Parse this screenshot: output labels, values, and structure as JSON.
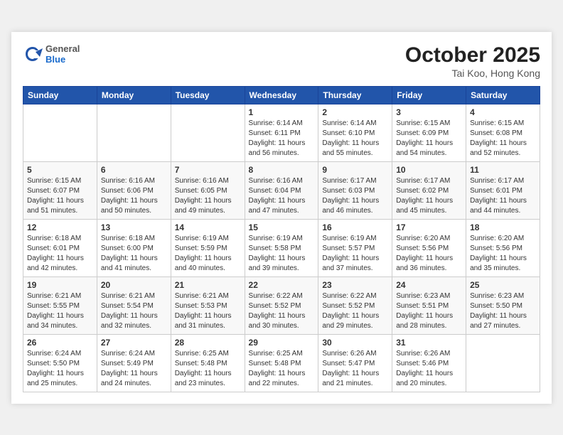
{
  "header": {
    "logo": {
      "general": "General",
      "blue": "Blue"
    },
    "title": "October 2025",
    "location": "Tai Koo, Hong Kong"
  },
  "weekdays": [
    "Sunday",
    "Monday",
    "Tuesday",
    "Wednesday",
    "Thursday",
    "Friday",
    "Saturday"
  ],
  "weeks": [
    [
      {
        "day": "",
        "info": ""
      },
      {
        "day": "",
        "info": ""
      },
      {
        "day": "",
        "info": ""
      },
      {
        "day": "1",
        "info": "Sunrise: 6:14 AM\nSunset: 6:11 PM\nDaylight: 11 hours\nand 56 minutes."
      },
      {
        "day": "2",
        "info": "Sunrise: 6:14 AM\nSunset: 6:10 PM\nDaylight: 11 hours\nand 55 minutes."
      },
      {
        "day": "3",
        "info": "Sunrise: 6:15 AM\nSunset: 6:09 PM\nDaylight: 11 hours\nand 54 minutes."
      },
      {
        "day": "4",
        "info": "Sunrise: 6:15 AM\nSunset: 6:08 PM\nDaylight: 11 hours\nand 52 minutes."
      }
    ],
    [
      {
        "day": "5",
        "info": "Sunrise: 6:15 AM\nSunset: 6:07 PM\nDaylight: 11 hours\nand 51 minutes."
      },
      {
        "day": "6",
        "info": "Sunrise: 6:16 AM\nSunset: 6:06 PM\nDaylight: 11 hours\nand 50 minutes."
      },
      {
        "day": "7",
        "info": "Sunrise: 6:16 AM\nSunset: 6:05 PM\nDaylight: 11 hours\nand 49 minutes."
      },
      {
        "day": "8",
        "info": "Sunrise: 6:16 AM\nSunset: 6:04 PM\nDaylight: 11 hours\nand 47 minutes."
      },
      {
        "day": "9",
        "info": "Sunrise: 6:17 AM\nSunset: 6:03 PM\nDaylight: 11 hours\nand 46 minutes."
      },
      {
        "day": "10",
        "info": "Sunrise: 6:17 AM\nSunset: 6:02 PM\nDaylight: 11 hours\nand 45 minutes."
      },
      {
        "day": "11",
        "info": "Sunrise: 6:17 AM\nSunset: 6:01 PM\nDaylight: 11 hours\nand 44 minutes."
      }
    ],
    [
      {
        "day": "12",
        "info": "Sunrise: 6:18 AM\nSunset: 6:01 PM\nDaylight: 11 hours\nand 42 minutes."
      },
      {
        "day": "13",
        "info": "Sunrise: 6:18 AM\nSunset: 6:00 PM\nDaylight: 11 hours\nand 41 minutes."
      },
      {
        "day": "14",
        "info": "Sunrise: 6:19 AM\nSunset: 5:59 PM\nDaylight: 11 hours\nand 40 minutes."
      },
      {
        "day": "15",
        "info": "Sunrise: 6:19 AM\nSunset: 5:58 PM\nDaylight: 11 hours\nand 39 minutes."
      },
      {
        "day": "16",
        "info": "Sunrise: 6:19 AM\nSunset: 5:57 PM\nDaylight: 11 hours\nand 37 minutes."
      },
      {
        "day": "17",
        "info": "Sunrise: 6:20 AM\nSunset: 5:56 PM\nDaylight: 11 hours\nand 36 minutes."
      },
      {
        "day": "18",
        "info": "Sunrise: 6:20 AM\nSunset: 5:56 PM\nDaylight: 11 hours\nand 35 minutes."
      }
    ],
    [
      {
        "day": "19",
        "info": "Sunrise: 6:21 AM\nSunset: 5:55 PM\nDaylight: 11 hours\nand 34 minutes."
      },
      {
        "day": "20",
        "info": "Sunrise: 6:21 AM\nSunset: 5:54 PM\nDaylight: 11 hours\nand 32 minutes."
      },
      {
        "day": "21",
        "info": "Sunrise: 6:21 AM\nSunset: 5:53 PM\nDaylight: 11 hours\nand 31 minutes."
      },
      {
        "day": "22",
        "info": "Sunrise: 6:22 AM\nSunset: 5:52 PM\nDaylight: 11 hours\nand 30 minutes."
      },
      {
        "day": "23",
        "info": "Sunrise: 6:22 AM\nSunset: 5:52 PM\nDaylight: 11 hours\nand 29 minutes."
      },
      {
        "day": "24",
        "info": "Sunrise: 6:23 AM\nSunset: 5:51 PM\nDaylight: 11 hours\nand 28 minutes."
      },
      {
        "day": "25",
        "info": "Sunrise: 6:23 AM\nSunset: 5:50 PM\nDaylight: 11 hours\nand 27 minutes."
      }
    ],
    [
      {
        "day": "26",
        "info": "Sunrise: 6:24 AM\nSunset: 5:50 PM\nDaylight: 11 hours\nand 25 minutes."
      },
      {
        "day": "27",
        "info": "Sunrise: 6:24 AM\nSunset: 5:49 PM\nDaylight: 11 hours\nand 24 minutes."
      },
      {
        "day": "28",
        "info": "Sunrise: 6:25 AM\nSunset: 5:48 PM\nDaylight: 11 hours\nand 23 minutes."
      },
      {
        "day": "29",
        "info": "Sunrise: 6:25 AM\nSunset: 5:48 PM\nDaylight: 11 hours\nand 22 minutes."
      },
      {
        "day": "30",
        "info": "Sunrise: 6:26 AM\nSunset: 5:47 PM\nDaylight: 11 hours\nand 21 minutes."
      },
      {
        "day": "31",
        "info": "Sunrise: 6:26 AM\nSunset: 5:46 PM\nDaylight: 11 hours\nand 20 minutes."
      },
      {
        "day": "",
        "info": ""
      }
    ]
  ]
}
